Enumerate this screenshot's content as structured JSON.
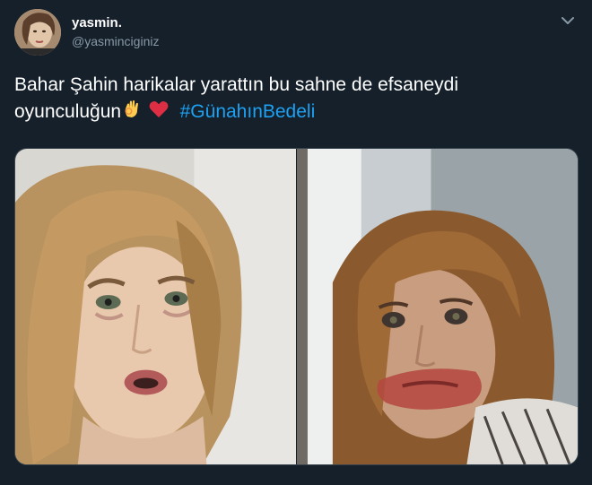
{
  "author": {
    "display_name": "yasmin.",
    "handle": "@yasminciginiz",
    "avatar_icon": "profile-photo"
  },
  "menu_icon": "chevron-down-icon",
  "tweet": {
    "text_line1": "Bahar Şahin harikalar yarattın bu sahne de efsaneydi",
    "text_line2": "oyunculuğun",
    "emojis": [
      "ok-hand-emoji",
      "red-heart-emoji"
    ],
    "hashtag": "#GünahınBedeli"
  },
  "media": {
    "count": 2,
    "photos": [
      "crying-woman-closeup-photo",
      "woman-smeared-lipstick-photo"
    ]
  },
  "colors": {
    "background": "#15202b",
    "accent": "#1da1f2",
    "secondary_text": "#8899a6"
  }
}
